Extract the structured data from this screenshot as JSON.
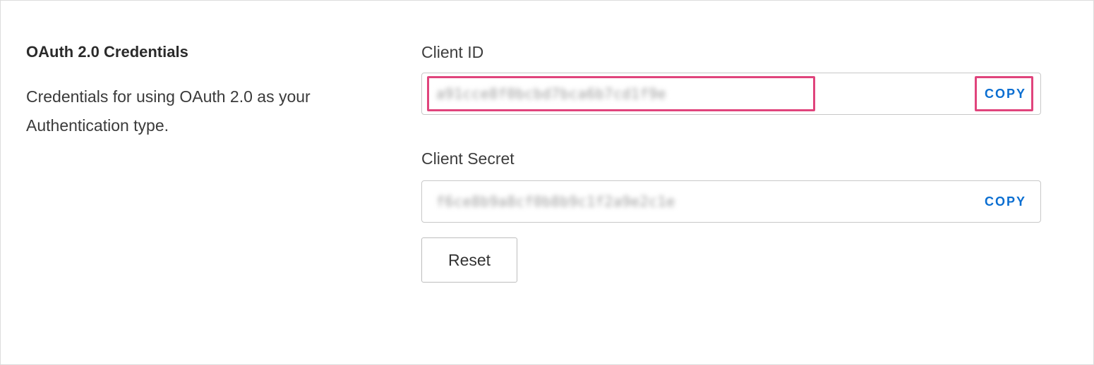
{
  "section": {
    "title": "OAuth 2.0 Credentials",
    "description": "Credentials for using OAuth 2.0 as your Authentication type."
  },
  "client_id": {
    "label": "Client ID",
    "value": "a91cce8f0bcbd7bca6b7cd1f9e",
    "copy_label": "COPY"
  },
  "client_secret": {
    "label": "Client Secret",
    "value": "f6ce8b9a8cf0b8b9c1f2a9e2c1e",
    "copy_label": "COPY"
  },
  "reset_label": "Reset",
  "colors": {
    "accent": "#0a6ed1",
    "highlight": "#e0447c"
  }
}
